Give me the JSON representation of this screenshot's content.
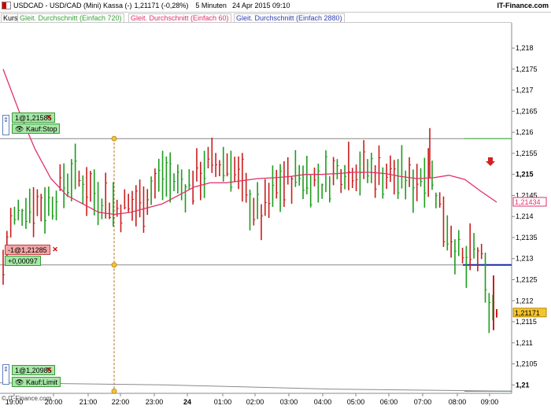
{
  "title": {
    "instrument": "USDCAD - USD/CAD (Mini) Kassa (-)",
    "quote": "1,21171 (-0,28%)",
    "interval": "5 Minuten",
    "datetime": "24 Apr 2015 09:10",
    "brand": "IT-Finance.com"
  },
  "legend": {
    "kurs": "Kurs",
    "ma720": "Gleit. Durchschnitt (Einfach 720)",
    "ma60": "Gleit. Durchschnitt (Einfach 60)",
    "ma2880": "Gleit. Durchschnitt (Einfach 2880)"
  },
  "orders": {
    "stop_buy": {
      "label": "1@1,21585",
      "action": "Kauf:Stop",
      "price": 1.21585
    },
    "position": {
      "label": "-1@1,21285",
      "pnl": "+0,00097",
      "price": 1.21285
    },
    "limit_buy": {
      "label": "1@1,20985",
      "action": "Kauf:Limit",
      "price": 1.20985
    }
  },
  "footer": "© IT-Finance.com",
  "colors": {
    "up": "#1e9c1e",
    "down": "#c81e1e",
    "ma60": "#e0306a",
    "ma720": "#3aa03a",
    "ma2880": "#8a8a8a",
    "position": "#1a2aa8",
    "last_price_bg": "#f4c430"
  },
  "chart_data": {
    "type": "candlestick",
    "ylim": [
      1.2098,
      1.2186
    ],
    "yticks": [
      "1,218",
      "1,2175",
      "1,217",
      "1,2165",
      "1,216",
      "1,2155",
      "1,215",
      "1,2145",
      "1,214",
      "1,2135",
      "1,213",
      "1,2125",
      "1,212",
      "1,2115",
      "1,211",
      "1,2105",
      "1,21"
    ],
    "ytick_values": [
      1.218,
      1.2175,
      1.217,
      1.2165,
      1.216,
      1.2155,
      1.215,
      1.2145,
      1.214,
      1.2135,
      1.213,
      1.2125,
      1.212,
      1.2115,
      1.211,
      1.2105,
      1.21
    ],
    "bold_ticks": [
      "1,215",
      "1,21"
    ],
    "xlabels": [
      "19:00",
      "20:00",
      "21:00",
      "22:00",
      "23:00",
      "24",
      "01:00",
      "02:00",
      "03:00",
      "04:00",
      "05:00",
      "06:00",
      "07:00",
      "08:00",
      "09:00"
    ],
    "ma60_label": "1,21434",
    "ma60_value": 1.21434,
    "last_label": "1,21171",
    "last_value": 1.21171,
    "lines": {
      "stop_buy": 1.21585,
      "position": 1.21285,
      "limit_buy": 1.20985
    },
    "ma60": [
      [
        0,
        1.2175
      ],
      [
        4,
        1.2165
      ],
      [
        8,
        1.2156
      ],
      [
        12,
        1.2149
      ],
      [
        16,
        1.2145
      ],
      [
        20,
        1.2143
      ],
      [
        24,
        1.2141
      ],
      [
        28,
        1.21405
      ],
      [
        32,
        1.2141
      ],
      [
        36,
        1.2142
      ],
      [
        40,
        1.2143
      ],
      [
        44,
        1.2145
      ],
      [
        48,
        1.2147
      ],
      [
        52,
        1.2148
      ],
      [
        56,
        1.2148
      ],
      [
        60,
        1.21485
      ],
      [
        64,
        1.2149
      ],
      [
        68,
        1.21492
      ],
      [
        72,
        1.21495
      ],
      [
        76,
        1.215
      ],
      [
        80,
        1.215
      ],
      [
        84,
        1.21502
      ],
      [
        88,
        1.21505
      ],
      [
        92,
        1.21505
      ],
      [
        96,
        1.21502
      ],
      [
        100,
        1.21495
      ],
      [
        104,
        1.2149
      ],
      [
        108,
        1.21492
      ],
      [
        112,
        1.21498
      ],
      [
        116,
        1.21488
      ],
      [
        120,
        1.2146
      ],
      [
        124,
        1.21434
      ]
    ],
    "ma720": [
      [
        0,
        1.2159
      ],
      [
        124,
        1.2159
      ]
    ],
    "ma2880": [
      [
        0,
        1.21005
      ],
      [
        40,
        1.21
      ],
      [
        80,
        1.2099
      ],
      [
        124,
        1.20985
      ]
    ]
  }
}
